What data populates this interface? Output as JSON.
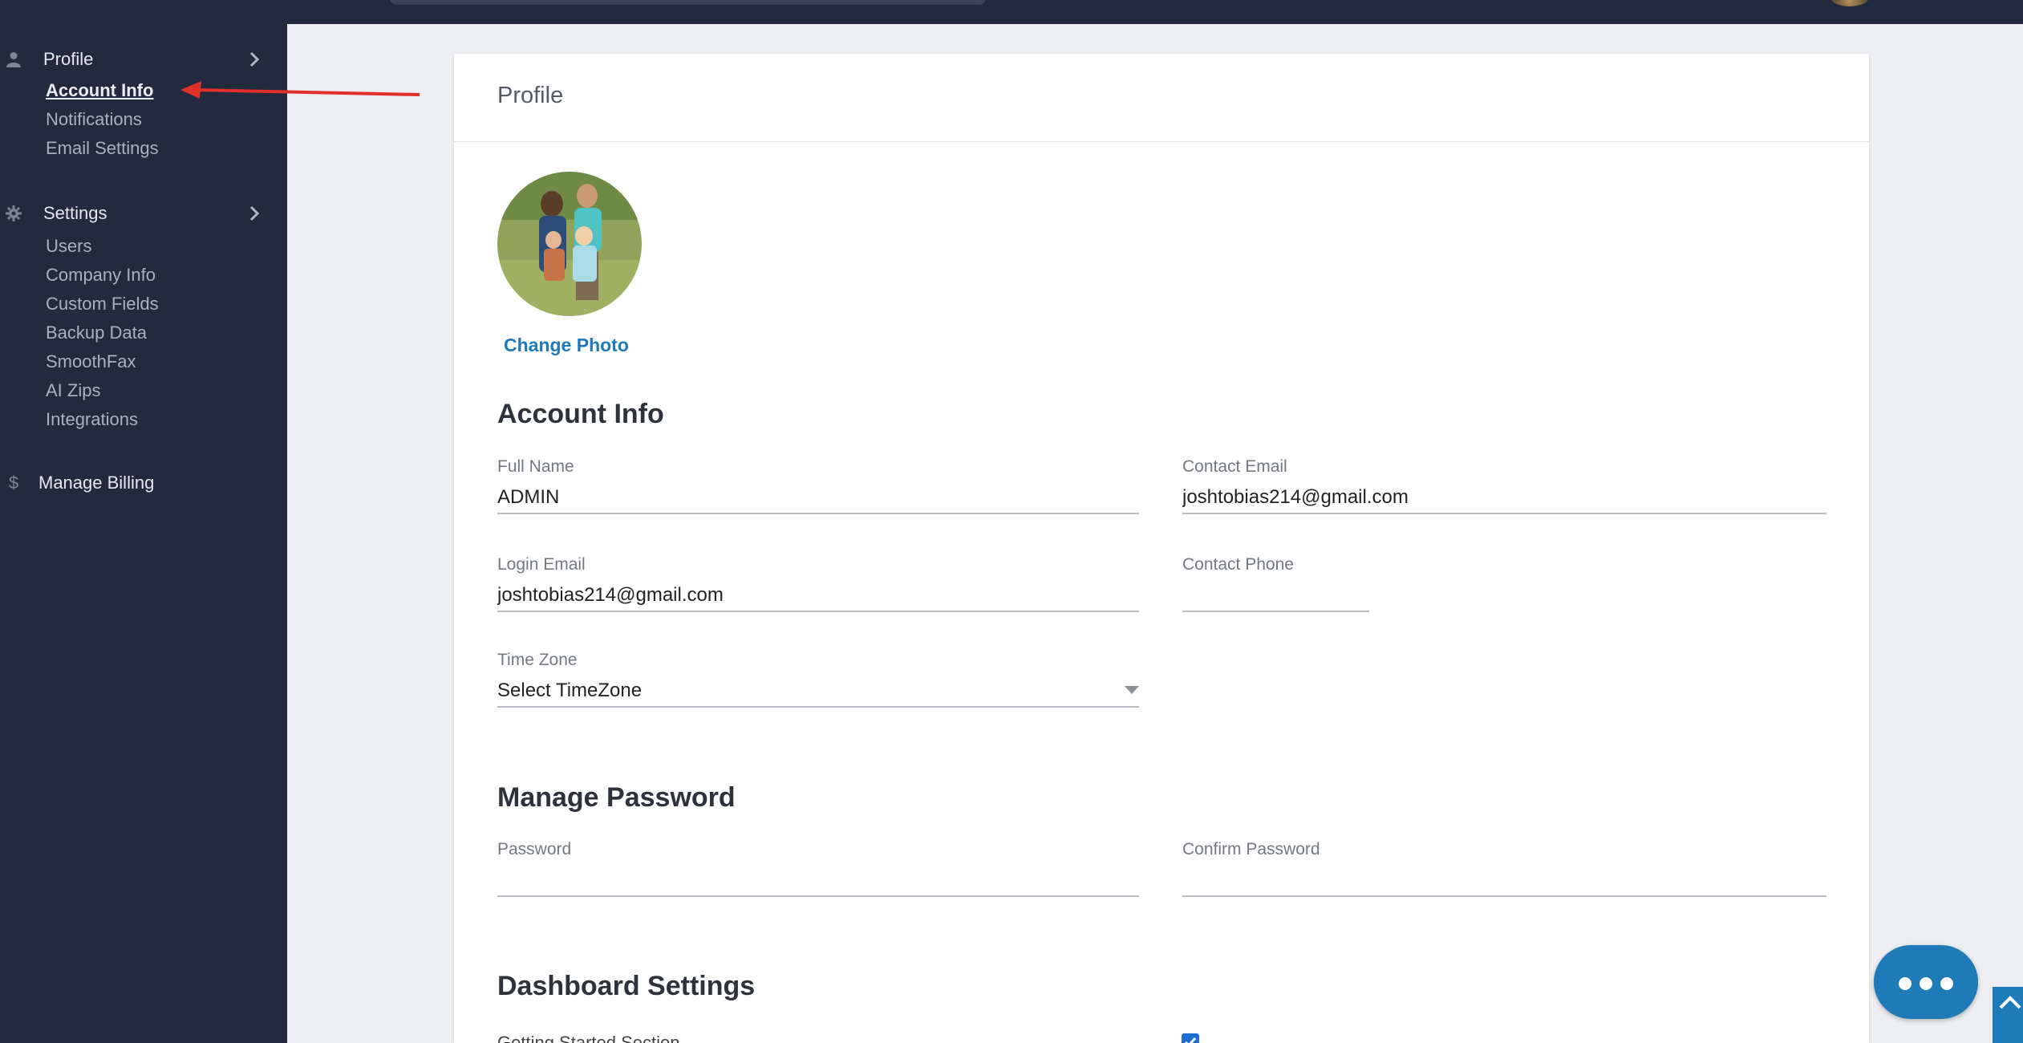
{
  "sidebar": {
    "profile": {
      "label": "Profile",
      "items": [
        "Account Info",
        "Notifications",
        "Email Settings"
      ]
    },
    "settings": {
      "label": "Settings",
      "items": [
        "Users",
        "Company Info",
        "Custom Fields",
        "Backup Data",
        "SmoothFax",
        "AI Zips",
        "Integrations"
      ]
    },
    "billing": {
      "label": "Manage Billing",
      "icon_glyph": "$"
    },
    "active_item": "Account Info"
  },
  "card": {
    "title": "Profile",
    "change_photo": "Change Photo",
    "account_info": {
      "heading": "Account Info",
      "full_name": {
        "label": "Full Name",
        "value": "ADMIN"
      },
      "contact_email": {
        "label": "Contact Email",
        "value": "joshtobias214@gmail.com"
      },
      "login_email": {
        "label": "Login Email",
        "value": "joshtobias214@gmail.com"
      },
      "contact_phone": {
        "label": "Contact Phone",
        "value": ""
      },
      "time_zone": {
        "label": "Time Zone",
        "value": "Select TimeZone"
      }
    },
    "manage_password": {
      "heading": "Manage Password",
      "password": {
        "label": "Password",
        "value": ""
      },
      "confirm_password": {
        "label": "Confirm Password",
        "value": ""
      }
    },
    "dashboard_settings": {
      "heading": "Dashboard Settings",
      "getting_started_label": "Getting Started Section",
      "getting_started_checked": true
    }
  },
  "colors": {
    "sidebar_bg": "#222a3e",
    "accent": "#1f7ab8",
    "annotation": "#e0302a"
  },
  "icons": {
    "profile": "user-icon",
    "settings": "gear-icon",
    "billing": "dollar-icon",
    "chat": "more-dots-icon",
    "scroll": "chevron-up-icon"
  }
}
